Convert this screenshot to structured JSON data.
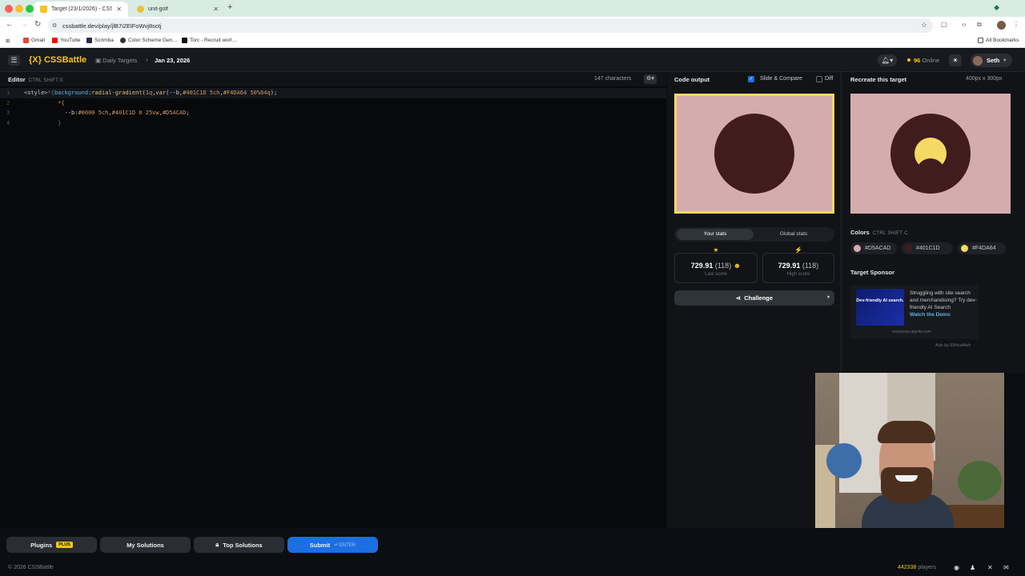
{
  "browser": {
    "tabs": [
      {
        "title": "Target (23/1/2026) - CSSBatt…",
        "active": true
      },
      {
        "title": "unit-golf",
        "active": false
      }
    ],
    "url": "cssbattle.dev/play/jlB7i2ElFoWvj8sctj",
    "bookmarks": [
      "Gmail",
      "YouTube",
      "Scrimba",
      "Color Scheme Gen…",
      "Torc - Recruit worl…"
    ],
    "all_bookmarks": "All Bookmarks"
  },
  "header": {
    "logo": "{X} CSSBattle",
    "breadcrumb": "Daily Targets",
    "date": "Jan 23, 2026",
    "online_count": "96",
    "online_label": "Online",
    "user": "Seth"
  },
  "editor": {
    "title": "Editor",
    "shortcut": "CTRL  SHIFT  E",
    "char_count": "147 characters",
    "line_numbers": [
      "1",
      "2",
      "3",
      "4"
    ]
  },
  "output": {
    "title": "Code output",
    "slide_compare": "Slide & Compare",
    "diff": "Diff"
  },
  "stats": {
    "tab_your": "Your stats",
    "tab_global": "Global stats",
    "last_score": "729.91",
    "last_chars": "(118)",
    "last_label": "Last score",
    "high_score": "729.91",
    "high_chars": "(118)",
    "high_label": "High score",
    "challenge": "Challenge"
  },
  "target": {
    "title": "Recreate this target",
    "size": "400px x 300px",
    "colors_title": "Colors",
    "colors_shortcut": "CTRL  SHIFT  C",
    "colors": [
      {
        "hex": "#D5ACAD",
        "swatch": "#d5acad"
      },
      {
        "hex": "#401C1D",
        "swatch": "#401c1d"
      },
      {
        "hex": "#F4DA64",
        "swatch": "#f4da64"
      }
    ],
    "sponsor_title": "Target Sponsor",
    "ad_image_text": "Dev-friendly AI search.",
    "ad_text": "Struggling with site search and merchandising? Try dev-friendly AI Search",
    "ad_cta": "Watch the Demo",
    "ad_source": "resources.algolia.com",
    "ads_by": "Ads by EthicalAds"
  },
  "bottom": {
    "plugins": "Plugins",
    "plus": "PLUS",
    "my_solutions": "My Solutions",
    "top_solutions": "Top Solutions",
    "submit": "Submit",
    "enter": "ENTER"
  },
  "footer": {
    "copyright": "© 2026 CSSBattle",
    "players_count": "442338",
    "players_label": "players"
  },
  "theme_colors": {
    "accent": "#f5c518",
    "submit_blue": "#1c6fe0",
    "pink": "#d5acad",
    "maroon": "#401c1d",
    "yellow": "#f4da64"
  }
}
